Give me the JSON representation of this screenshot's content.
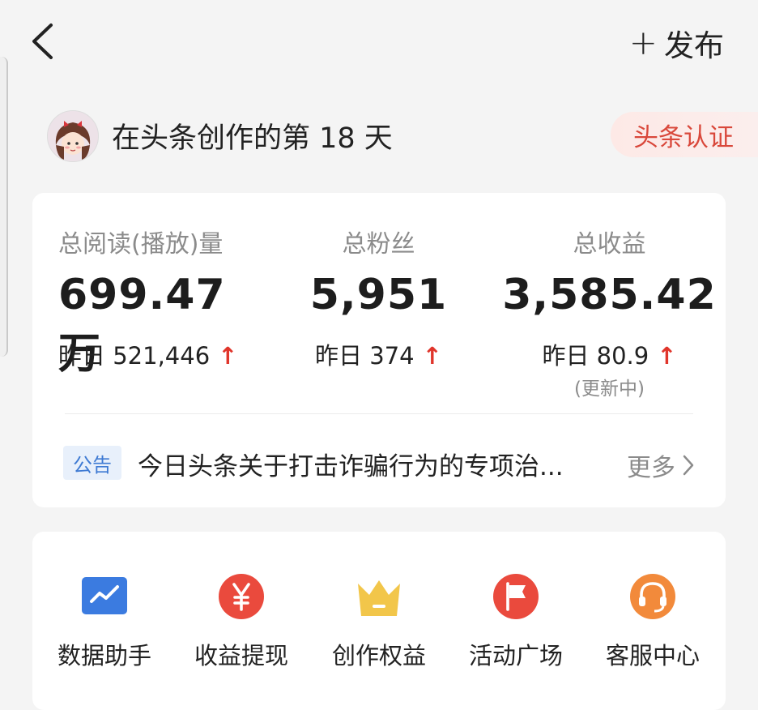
{
  "header": {
    "back_icon": "chevron-left-icon",
    "publish_plus": "+",
    "publish_label": "发布"
  },
  "profile": {
    "avatar_icon": "cartoon-girl-avatar",
    "text": "在头条创作的第 18 天",
    "cert_label": "头条认证"
  },
  "stats": [
    {
      "label": "总阅读(播放)量",
      "value": "699.47万",
      "yesterday": "昨日 521,446",
      "trend": "↑"
    },
    {
      "label": "总粉丝",
      "value": "5,951",
      "yesterday": "昨日 374",
      "trend": "↑"
    },
    {
      "label": "总收益",
      "value": "3,585.42",
      "yesterday": "昨日 80.9",
      "trend": "↑",
      "note": "(更新中)"
    }
  ],
  "notice": {
    "tag": "公告",
    "text": "今日头条关于打击诈骗行为的专项治...",
    "more_label": "更多"
  },
  "tools": [
    {
      "label": "数据助手",
      "icon": "chart-icon",
      "color": "#3b7be0"
    },
    {
      "label": "收益提现",
      "icon": "yen-icon",
      "color": "#ea4a3d"
    },
    {
      "label": "创作权益",
      "icon": "crown-icon",
      "color": "#f2c64a"
    },
    {
      "label": "活动广场",
      "icon": "flag-icon",
      "color": "#ea4a3d"
    },
    {
      "label": "客服中心",
      "icon": "headset-icon",
      "color": "#f28a3b"
    }
  ],
  "colors": {
    "accent_red": "#e0352b",
    "badge_text": "#d9483b",
    "notice_tag": "#3e7ad3",
    "muted": "#8b8b8b"
  }
}
